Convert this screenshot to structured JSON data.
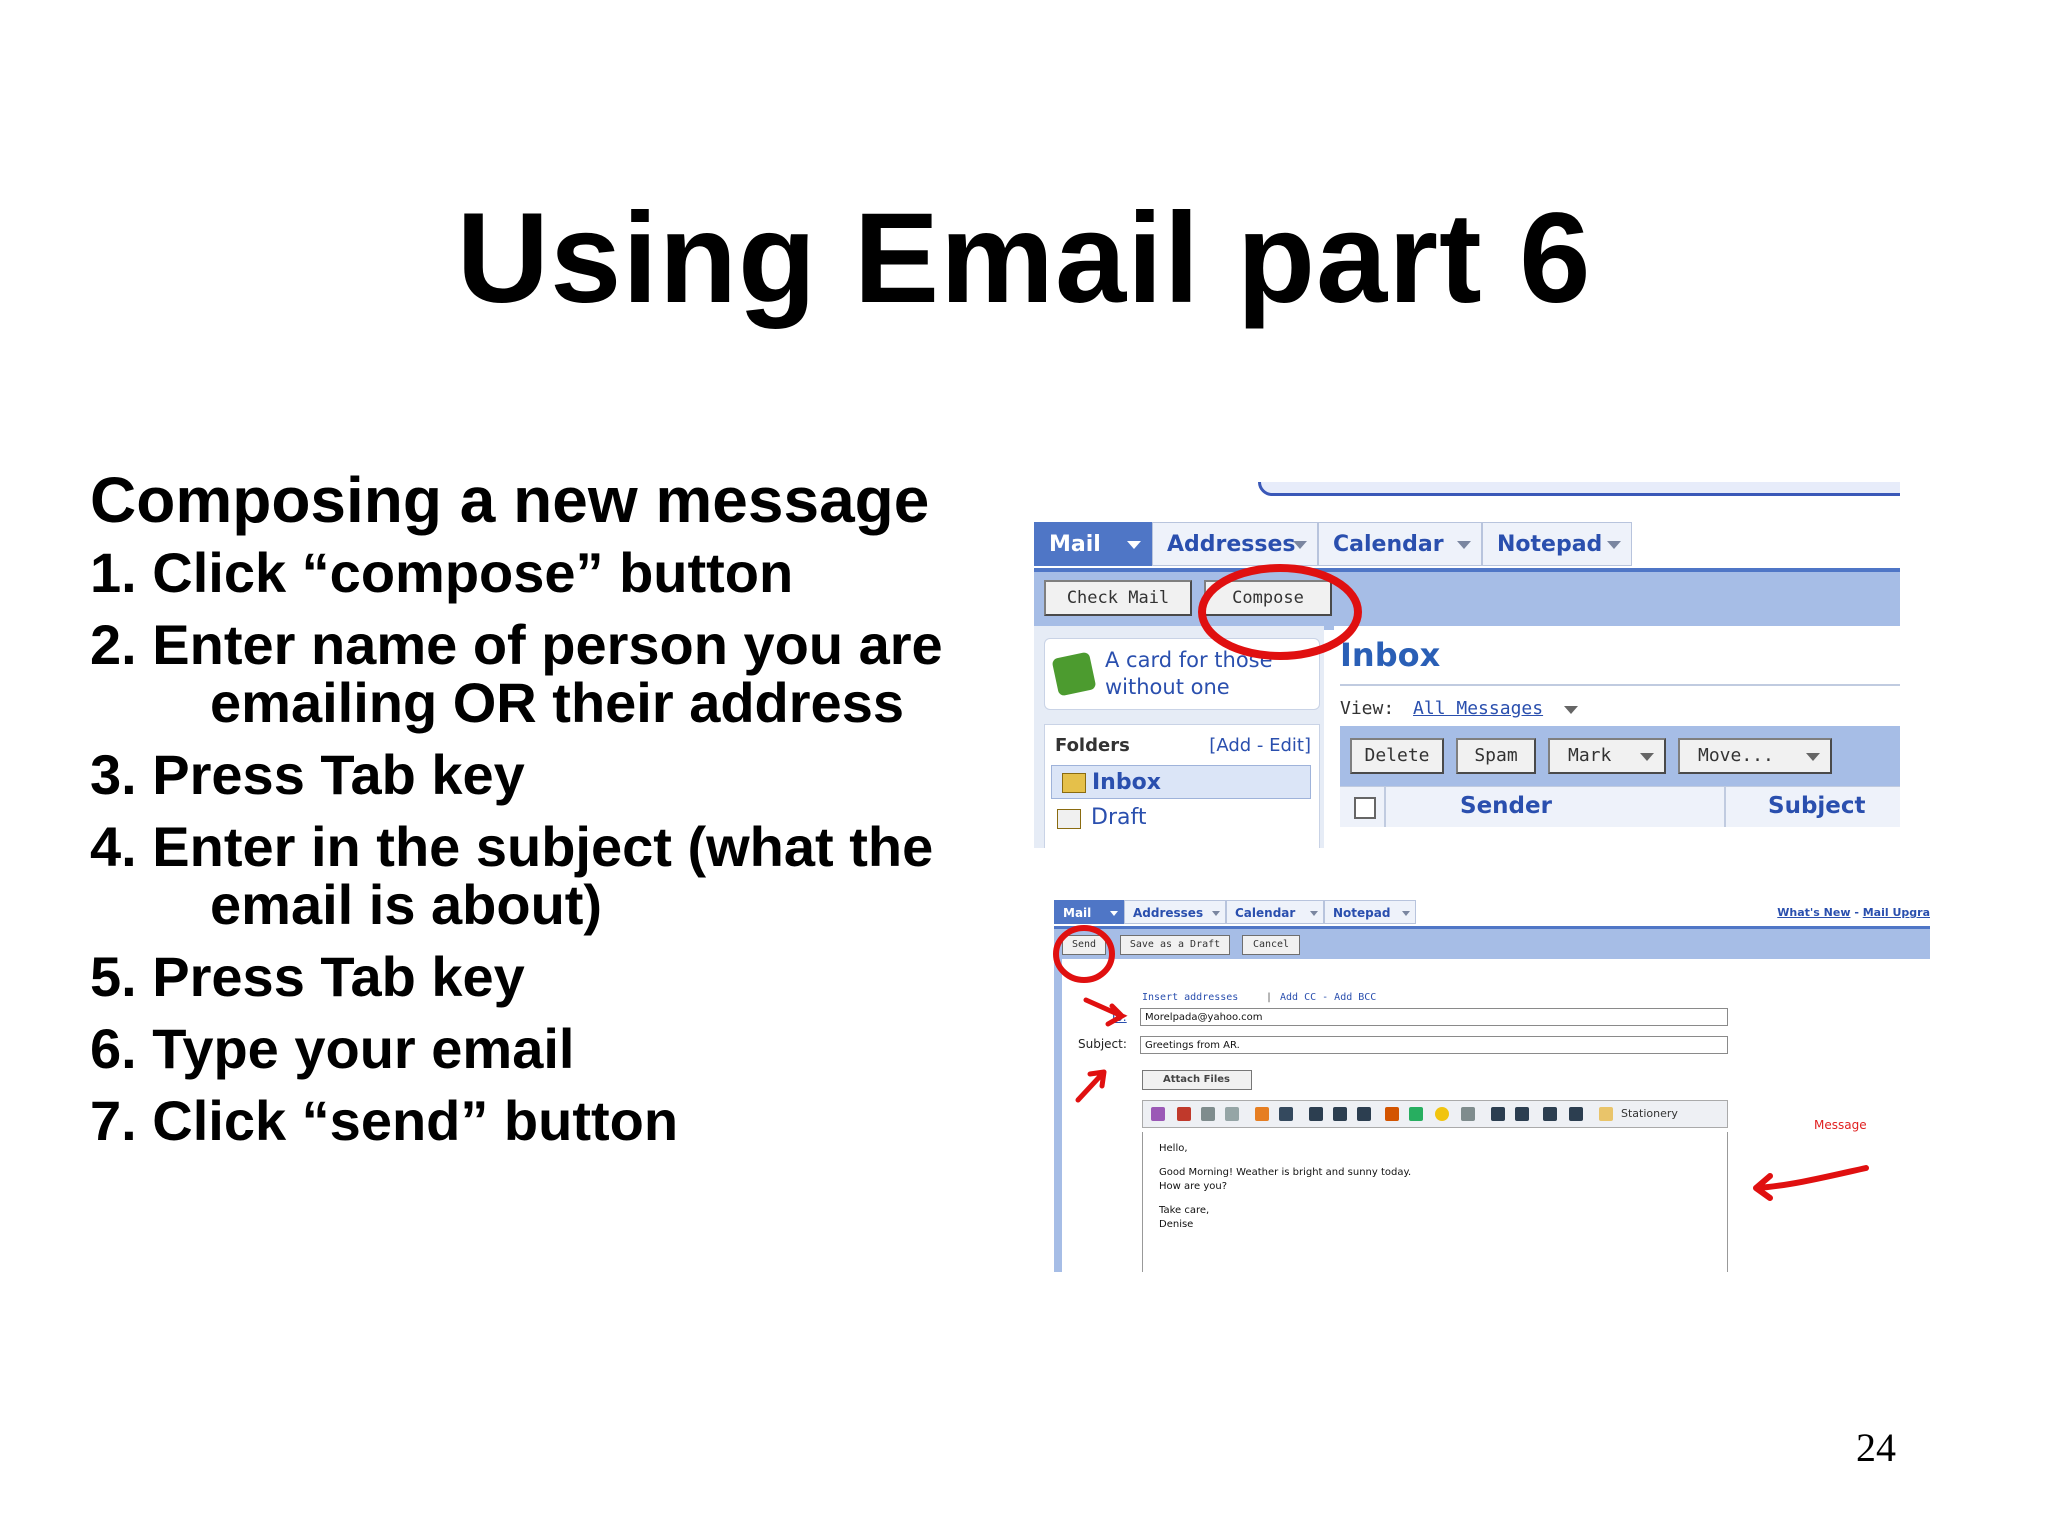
{
  "slide": {
    "title": "Using Email part 6",
    "heading": "Composing a new message",
    "steps": [
      {
        "num": "1.",
        "text": "Click “compose” button",
        "cont": ""
      },
      {
        "num": "2.",
        "text": "Enter name of person you are",
        "cont": "emailing OR their address"
      },
      {
        "num": "3.",
        "text": "Press Tab key",
        "cont": ""
      },
      {
        "num": "4.",
        "text": "Enter in the subject (what the",
        "cont": "email is about)"
      },
      {
        "num": "5.",
        "text": "Press Tab key",
        "cont": ""
      },
      {
        "num": "6.",
        "text": "Type your email",
        "cont": ""
      },
      {
        "num": "7.",
        "text": "Click “send” button",
        "cont": ""
      }
    ],
    "page_number": "24"
  },
  "inbox_shot": {
    "tabs": [
      "Mail",
      "Addresses",
      "Calendar",
      "Notepad"
    ],
    "check_mail": "Check Mail",
    "compose": "Compose",
    "promo_line1": "A card for those",
    "promo_line2": "without one",
    "folders_label": "Folders",
    "folders_edit": "[Add - Edit]",
    "inbox_folder": "Inbox",
    "draft_folder": "Draft",
    "inbox_title": "Inbox",
    "view_label": "View:",
    "view_value": "All Messages",
    "actions": [
      "Delete",
      "Spam",
      "Mark",
      "Move..."
    ],
    "col_sender": "Sender",
    "col_subject": "Subject",
    "accent_color": "#4f76c6",
    "annotation_color": "#e01010"
  },
  "compose_shot": {
    "tabs": [
      "Mail",
      "Addresses",
      "Calendar",
      "Notepad"
    ],
    "whats_new": "What's New",
    "mail_upgrade": "Mail Upgra",
    "send": "Send",
    "save_draft": "Save as a Draft",
    "cancel": "Cancel",
    "insert_addresses": "Insert addresses",
    "add_cc": "Add CC - Add BCC",
    "to_label": "To:",
    "to_value": "Morelpada@yahoo.com",
    "subject_label": "Subject:",
    "subject_value": "Greetings from AR.",
    "attach": "Attach Files",
    "stationery": "Stationery",
    "message_label": "Message",
    "body_lines": [
      "Hello,",
      "Good Morning!  Weather is bright and sunny today.",
      "How are you?",
      "Take care,",
      "Denise"
    ]
  }
}
